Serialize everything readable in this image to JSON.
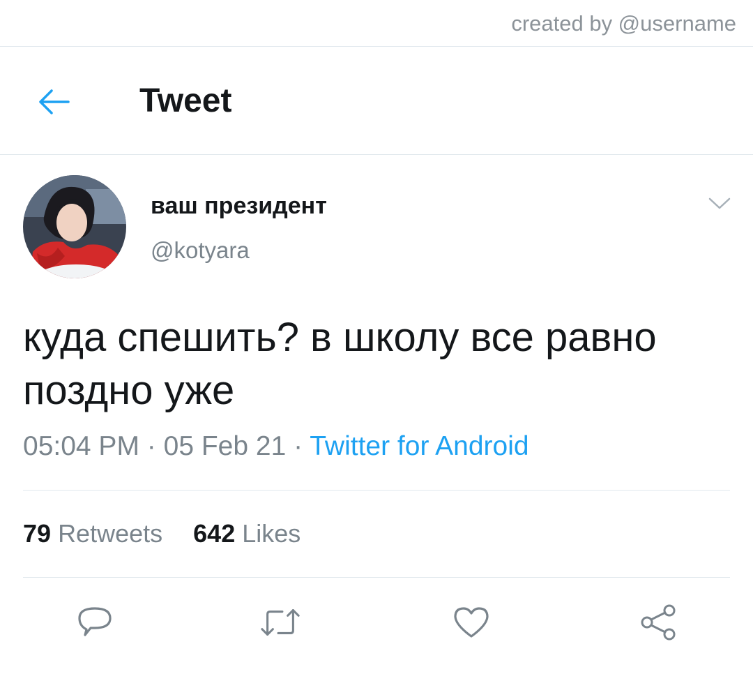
{
  "watermark": "created by @username",
  "header": {
    "title": "Tweet",
    "back_icon": "back-arrow-icon",
    "accent": "#1da1f2"
  },
  "author": {
    "display_name": "ваш президент",
    "handle": "@kotyara"
  },
  "tweet": {
    "text": "куда спешить? в школу все равно поздно уже",
    "time": "05:04 PM",
    "date": "05 Feb 21",
    "separator": "·",
    "source": "Twitter for Android"
  },
  "stats": {
    "retweets_count": "79",
    "retweets_label": "Retweets",
    "likes_count": "642",
    "likes_label": "Likes"
  },
  "actions": [
    "reply-icon",
    "retweet-icon",
    "like-icon",
    "share-icon"
  ],
  "colors": {
    "text": "#14171a",
    "secondary": "#7a848c",
    "link": "#1da1f2",
    "divider": "#e1e8ed"
  }
}
